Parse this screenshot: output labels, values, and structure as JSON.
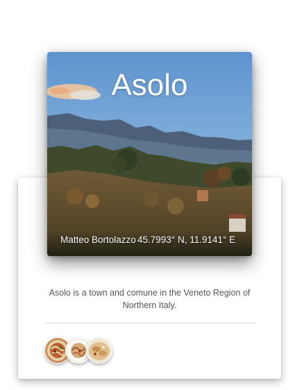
{
  "place": {
    "name": "Asolo",
    "photo_credit": "Matteo Bortolazzo",
    "coordinates": "45.7993° N, 11.9141° E",
    "description": "Asolo is a town and comune in the Veneto Region of Northern Italy."
  },
  "thumbnails": [
    {
      "name": "food-thumbnail-1"
    },
    {
      "name": "food-thumbnail-2"
    },
    {
      "name": "food-thumbnail-3"
    }
  ]
}
